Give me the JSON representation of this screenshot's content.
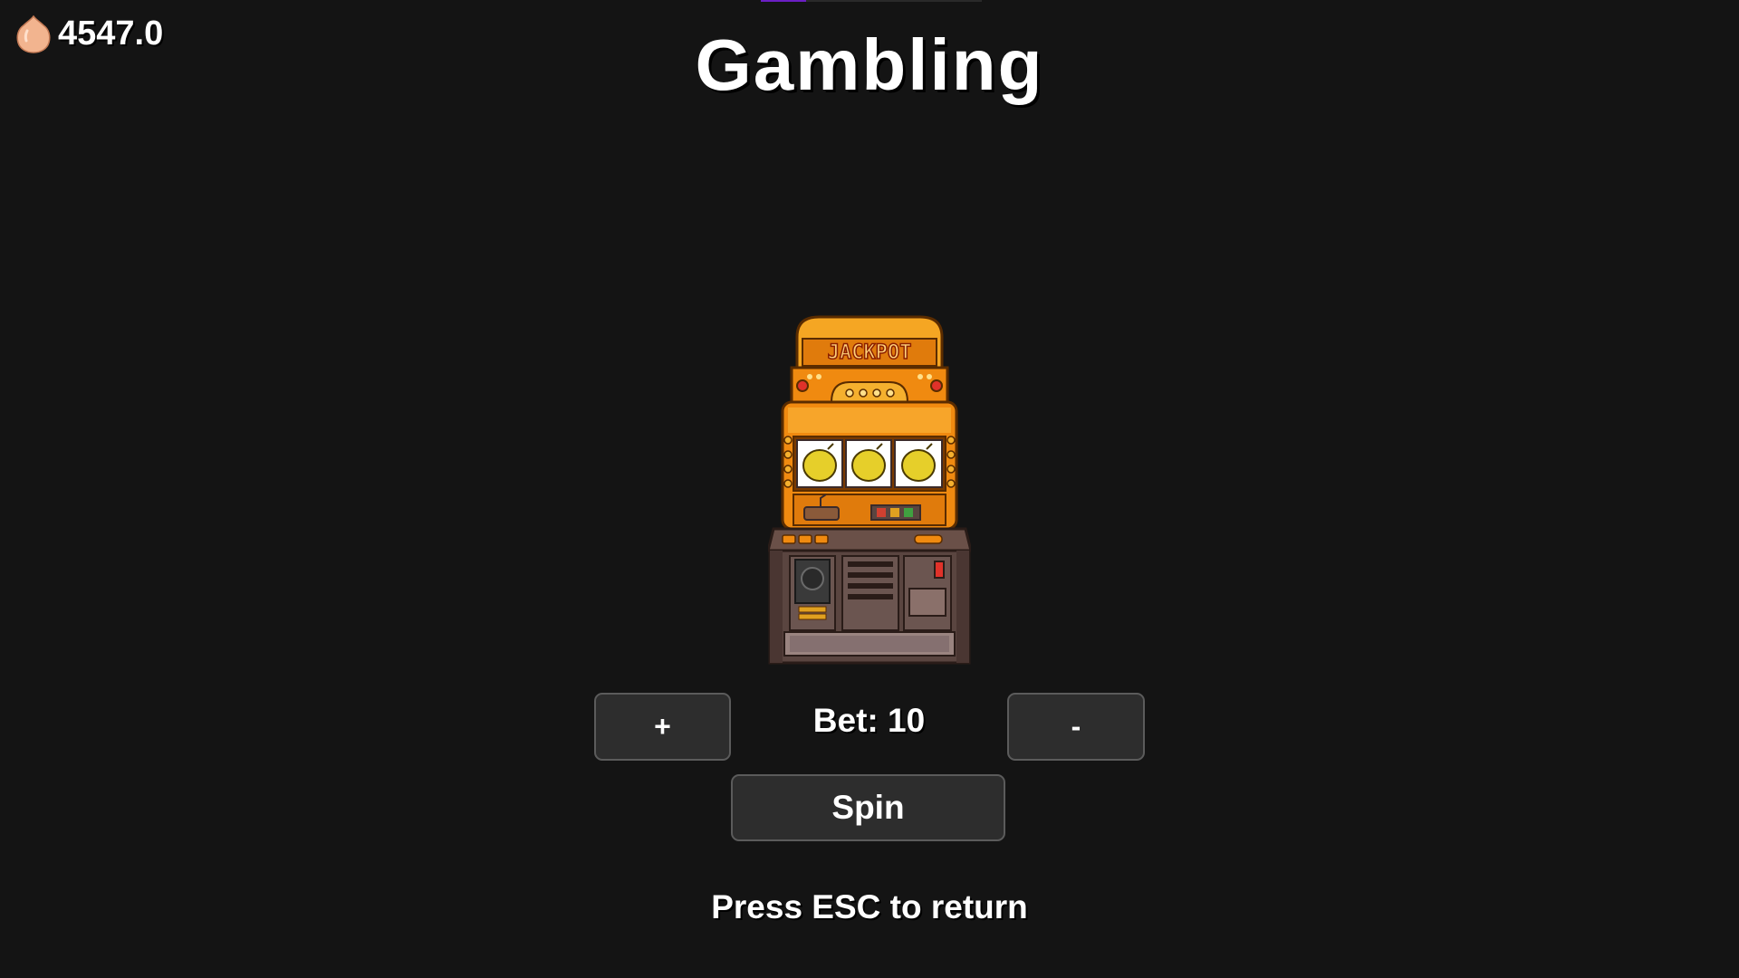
{
  "hud": {
    "currency_icon": "peach-blob-icon",
    "currency_value": "4547.0"
  },
  "title": "Gambling",
  "machine": {
    "icon": "slot-machine-icon",
    "sign_text": "JACKPOT",
    "reels": [
      "lemon",
      "lemon",
      "lemon"
    ]
  },
  "controls": {
    "plus_label": "+",
    "minus_label": "-",
    "bet_text": "Bet: 10",
    "spin_label": "Spin"
  },
  "footer": {
    "hint": "Press ESC to return"
  },
  "colors": {
    "background": "#141414",
    "button_bg": "#2d2d2d",
    "button_border": "#5b5b5b",
    "machine_orange": "#f08a10",
    "machine_base": "#5a4540"
  }
}
